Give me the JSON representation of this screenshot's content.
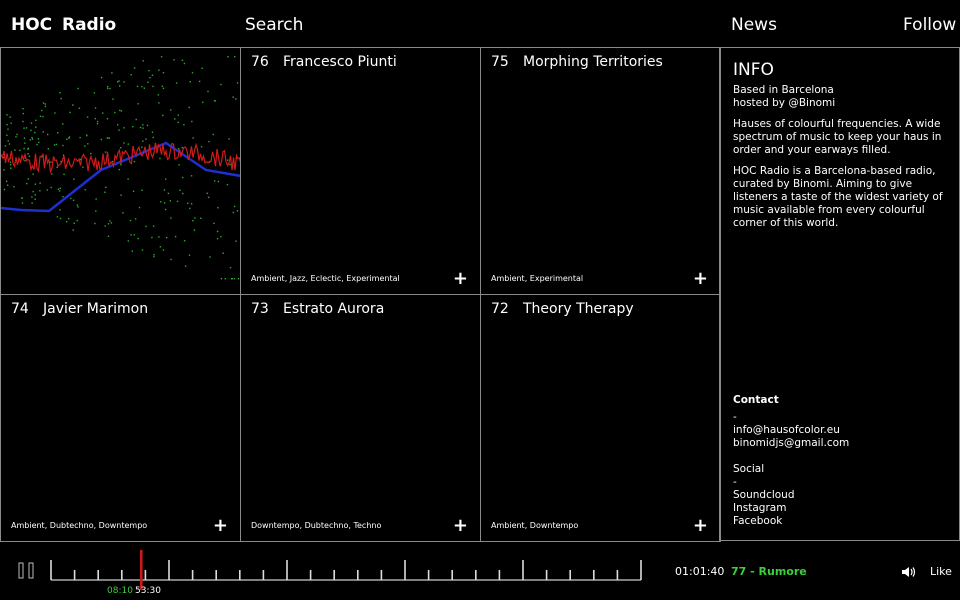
{
  "nav": {
    "brand": "HOC",
    "radio": "Radio",
    "search": "Search",
    "news": "News",
    "follow": "Follow"
  },
  "episodes": [
    {
      "num": "76",
      "title": "Francesco Piunti",
      "tags": "Ambient, Jazz, Eclectic, Experimental"
    },
    {
      "num": "75",
      "title": "Morphing Territories",
      "tags": "Ambient, Experimental"
    },
    {
      "num": "74",
      "title": "Javier Marimon",
      "tags": "Ambient, Dubtechno, Downtempo"
    },
    {
      "num": "73",
      "title": "Estrato Aurora",
      "tags": "Downtempo, Dubtechno, Techno"
    },
    {
      "num": "72",
      "title": "Theory Therapy",
      "tags": "Ambient, Downtempo"
    }
  ],
  "plus_icon": "+",
  "info": {
    "title": "INFO",
    "location": "Based in Barcelona",
    "host": "hosted by @Binomi",
    "para1": "Hauses of colourful frequencies. A wide spectrum of music to keep your haus in order and your earways filled.",
    "para2": "HOC Radio is a Barcelona-based radio, curated by Binomi. Aiming to give listeners a taste of the widest variety of music available from every colourful corner of this world.",
    "contact_head": "Contact",
    "dash": "-",
    "email1": "info@hausofcolor.eu",
    "email2": "binomidjs@gmail.com",
    "social_head": "Social",
    "soundcloud": "Soundcloud",
    "instagram": "Instagram",
    "facebook": "Facebook"
  },
  "player": {
    "elapsed": "08:10",
    "total": "53:30",
    "progress": 0.153,
    "clock": "01:01:40",
    "now_playing": "77 - Rumore",
    "like": "Like",
    "pause_icon": "pause-icon",
    "volume_icon": "speaker-icon",
    "colors": {
      "accent_green": "#3ccf3c",
      "playhead": "#d11a1a"
    }
  },
  "visual_colors": {
    "red": "#d11a1a",
    "blue": "#1f2fd0",
    "green": "#2fa82f",
    "border": "#8a8a8a"
  }
}
